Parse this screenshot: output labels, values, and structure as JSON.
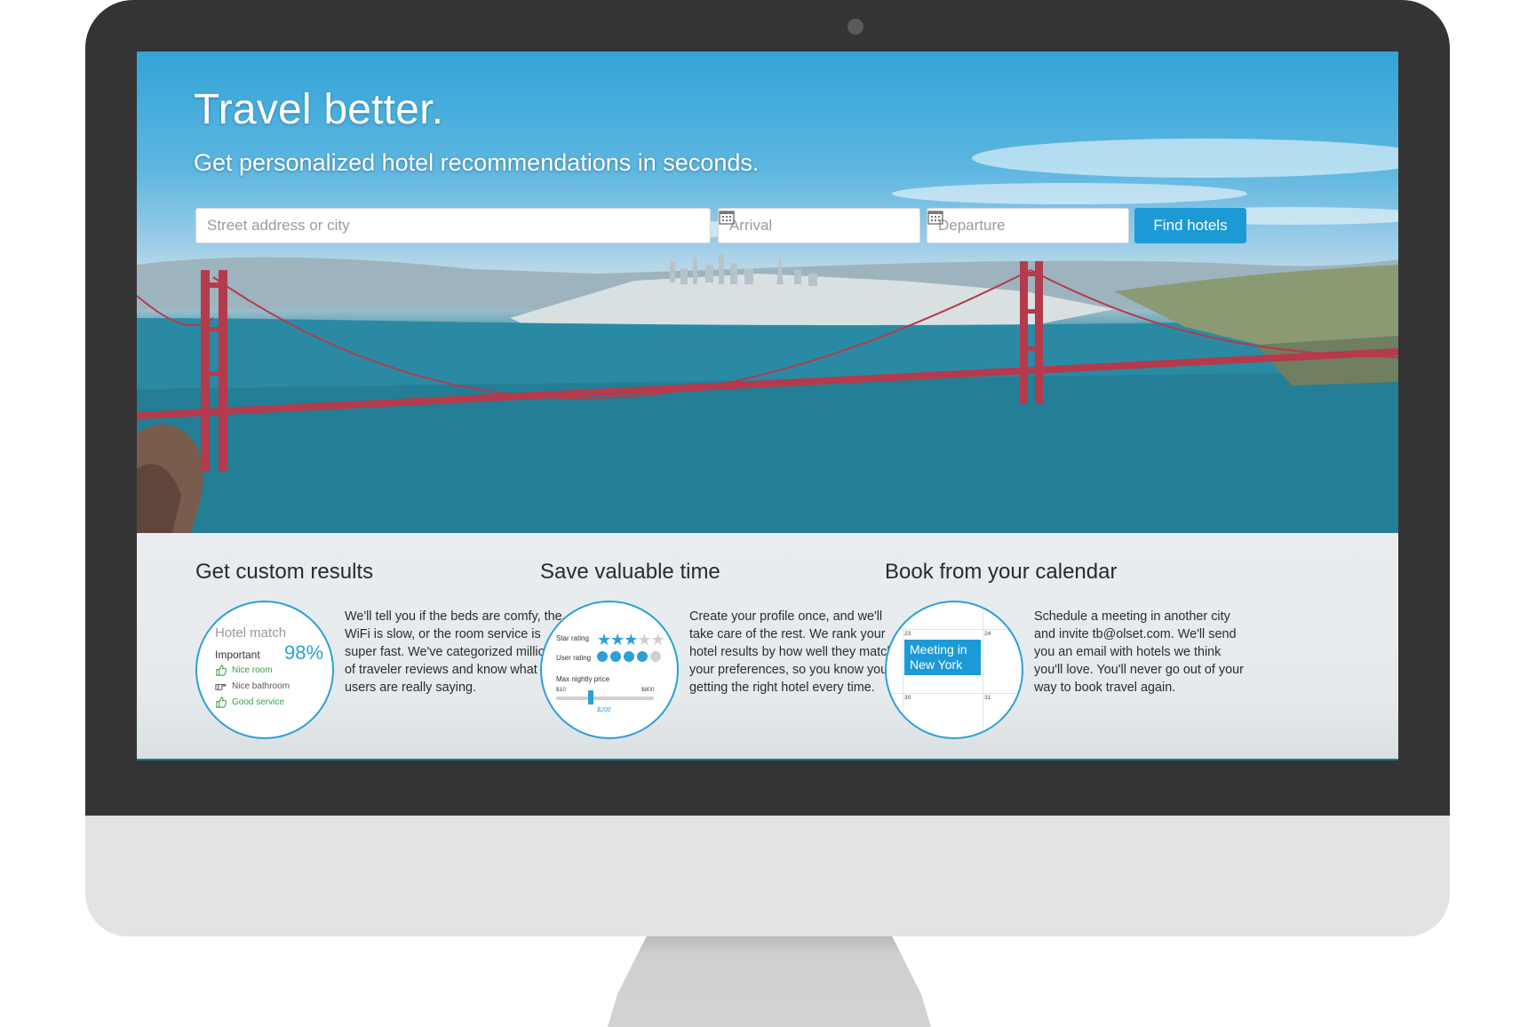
{
  "hero": {
    "title": "Travel better.",
    "subtitle": "Get personalized hotel recommendations in seconds."
  },
  "search": {
    "location_placeholder": "Street address or city",
    "arrival_placeholder": "Arrival",
    "departure_placeholder": "Departure",
    "find_label": "Find hotels"
  },
  "features": [
    {
      "title": "Get custom results",
      "text": "We'll tell you if the beds are comfy, the WiFi is slow, or the room service is super fast. We've categorized millions of traveler reviews and know what users are really saying.",
      "widget": {
        "title": "Hotel match",
        "important": "Important",
        "percent": "98%",
        "items": [
          "Nice room",
          "Nice bathroom",
          "Good service"
        ]
      }
    },
    {
      "title": "Save valuable time",
      "text": "Create your profile once, and we'll take care of the rest. We rank your hotel results by how well they match your preferences, so you know you're getting the right hotel every time.",
      "widget": {
        "star_label": "Star rating",
        "user_label": "User rating",
        "price_label": "Max nightly price",
        "min": "$10",
        "max": "$800",
        "value": "$200",
        "star_rating": 3,
        "star_max": 5,
        "user_rating": 4,
        "user_max": 5
      }
    },
    {
      "title": "Book from your calendar",
      "text": "Schedule a meeting in another city and invite tb@olset.com. We'll send you an email with hotels we think you'll love. You'll never go out of your way to book travel again.",
      "widget": {
        "event": "Meeting in New York",
        "dates": [
          "23",
          "24",
          "30",
          "31"
        ]
      }
    }
  ],
  "colors": {
    "accent": "#1c9ad6",
    "bezel": "#343434",
    "bridge": "#b43a4c",
    "good": "#3aa04a"
  }
}
